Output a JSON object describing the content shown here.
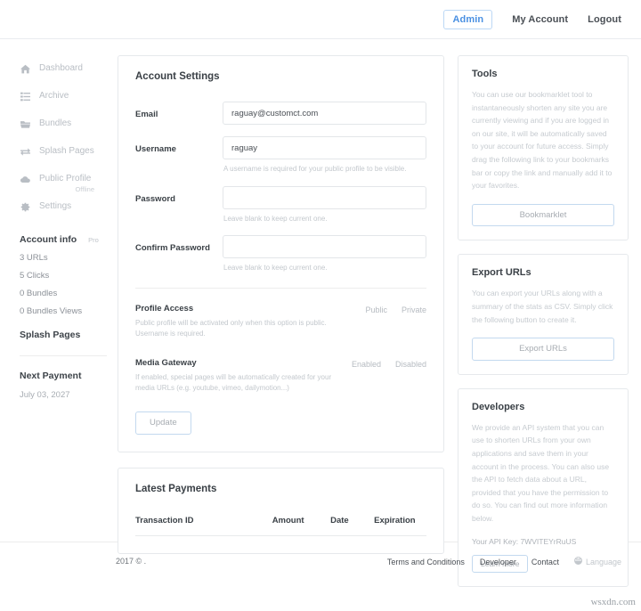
{
  "topnav": {
    "items": [
      {
        "label": "Admin",
        "active": true
      },
      {
        "label": "My Account",
        "active": false
      },
      {
        "label": "Logout",
        "active": false
      }
    ]
  },
  "sidebar": {
    "nav": [
      {
        "label": "Dashboard",
        "icon": "home-icon"
      },
      {
        "label": "Archive",
        "icon": "list-icon"
      },
      {
        "label": "Bundles",
        "icon": "folder-icon"
      },
      {
        "label": "Splash Pages",
        "icon": "exchange-icon"
      },
      {
        "label": "Public Profile",
        "icon": "cloud-icon",
        "sub": "Offline"
      },
      {
        "label": "Settings",
        "icon": "gear-icon"
      }
    ],
    "account_info": {
      "title": "Account info",
      "badge": "Pro"
    },
    "stats": [
      {
        "label": "3 URLs"
      },
      {
        "label": "5 Clicks"
      },
      {
        "label": "0 Bundles"
      },
      {
        "label": "0 Bundles Views"
      }
    ],
    "splash_pages_label": "Splash Pages",
    "next_payment": {
      "title": "Next Payment",
      "date": "July 03, 2027"
    }
  },
  "account_settings": {
    "title": "Account Settings",
    "email": {
      "label": "Email",
      "value": "raguay@customct.com",
      "placeholder": ""
    },
    "username": {
      "label": "Username",
      "value": "raguay",
      "placeholder": "",
      "hint": "A username is required for your public profile to be visible."
    },
    "password": {
      "label": "Password",
      "value": "",
      "placeholder": "",
      "hint": "Leave blank to keep current one."
    },
    "confirm_password": {
      "label": "Confirm Password",
      "value": "",
      "placeholder": "",
      "hint": "Leave blank to keep current one."
    },
    "profile_access": {
      "title": "Profile Access",
      "desc": "Public profile will be activated only when this option is public. Username is required.",
      "option_a": "Public",
      "option_b": "Private"
    },
    "media_gateway": {
      "title": "Media Gateway",
      "desc": "If enabled, special pages will be automatically created for your media URLs (e.g. youtube, vimeo, dailymotion...)",
      "option_a": "Enabled",
      "option_b": "Disabled"
    },
    "update_button": "Update"
  },
  "latest_payments": {
    "title": "Latest Payments",
    "columns": [
      "Transaction ID",
      "Amount",
      "Date",
      "Expiration"
    ],
    "rows": []
  },
  "tools": {
    "title": "Tools",
    "body": "You can use our bookmarklet tool to instantaneously shorten any site you are currently viewing and if you are logged in on our site, it will be automatically saved to your account for future access. Simply drag the following link to your bookmarks bar or copy the link and manually add it to your favorites.",
    "button": "Bookmarklet"
  },
  "export_urls": {
    "title": "Export URLs",
    "body": "You can export your URLs along with a summary of the stats as CSV. Simply click the following button to create it.",
    "button": "Export URLs"
  },
  "developers": {
    "title": "Developers",
    "body": "We provide an API system that you can use to shorten URLs from your own applications and save them in your account in the process. You can also use the API to fetch data about a URL, provided that you have the permission to do so. You can find out more information below.",
    "api_key_label": "Your API Key: 7WVITEYrRuUS",
    "button": "Learn more"
  },
  "footer": {
    "copyright": "2017 © .",
    "links": [
      "Terms and Conditions",
      "Developer",
      "Contact"
    ],
    "language": "Language"
  },
  "watermark": "wsxdn.com",
  "colors": {
    "accent": "#4a90e2",
    "accent_border": "#bcd8f5",
    "text": "#3d4349",
    "muted": "#c3c8cd",
    "card_border": "#e6e9ec"
  }
}
